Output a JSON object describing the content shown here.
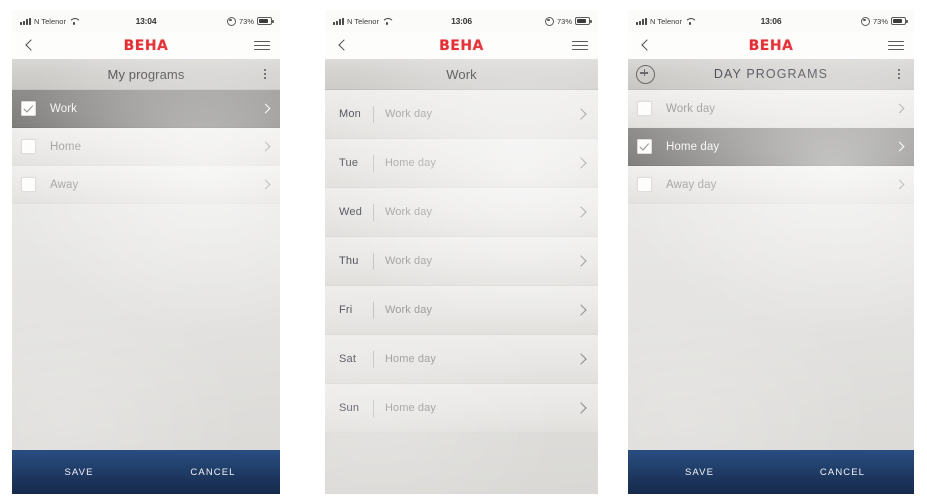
{
  "panels": [
    {
      "id": "my-programs",
      "status": {
        "carrier": "N Telenor",
        "time": "13:04",
        "battery": "73%",
        "signal_icon": "signal-bars-icon",
        "wifi_icon": "wifi-icon",
        "lock_icon": "rotation-lock-icon",
        "battery_icon": "battery-icon"
      },
      "header": {
        "back_icon": "back-chevron-icon",
        "brand": "BEHA",
        "menu_icon": "hamburger-menu-icon"
      },
      "titlebar": {
        "title": "My programs",
        "has_add": false,
        "has_kebab": true,
        "kebab_icon": "kebab-menu-icon"
      },
      "rows": [
        {
          "label": "Work",
          "checked": true,
          "selected": true
        },
        {
          "label": "Home",
          "checked": false,
          "selected": false
        },
        {
          "label": "Away",
          "checked": false,
          "selected": false
        }
      ],
      "actions": {
        "save": "SAVE",
        "cancel": "CANCEL",
        "visible": true
      }
    },
    {
      "id": "work-week",
      "status": {
        "carrier": "N Telenor",
        "time": "13:06",
        "battery": "73%",
        "signal_icon": "signal-bars-icon",
        "wifi_icon": "wifi-icon",
        "lock_icon": "rotation-lock-icon",
        "battery_icon": "battery-icon"
      },
      "header": {
        "back_icon": "back-chevron-icon",
        "brand": "BEHA",
        "menu_icon": "hamburger-menu-icon"
      },
      "titlebar": {
        "title": "Work",
        "has_add": false,
        "has_kebab": false
      },
      "days": [
        {
          "day": "Mon",
          "value": "Work day"
        },
        {
          "day": "Tue",
          "value": "Home day"
        },
        {
          "day": "Wed",
          "value": "Work day"
        },
        {
          "day": "Thu",
          "value": "Work day"
        },
        {
          "day": "Fri",
          "value": "Work day"
        },
        {
          "day": "Sat",
          "value": "Home day"
        },
        {
          "day": "Sun",
          "value": "Home day"
        }
      ],
      "actions": {
        "visible": false
      }
    },
    {
      "id": "day-programs",
      "status": {
        "carrier": "N Telenor",
        "time": "13:06",
        "battery": "73%",
        "signal_icon": "signal-bars-icon",
        "wifi_icon": "wifi-icon",
        "lock_icon": "rotation-lock-icon",
        "battery_icon": "battery-icon"
      },
      "header": {
        "back_icon": "back-chevron-icon",
        "brand": "BEHA",
        "menu_icon": "hamburger-menu-icon"
      },
      "titlebar": {
        "title": "DAY PROGRAMS",
        "has_add": true,
        "add_icon": "plus-circle-icon",
        "has_kebab": true,
        "kebab_icon": "kebab-menu-icon"
      },
      "rows": [
        {
          "label": "Work day",
          "checked": false,
          "selected": false
        },
        {
          "label": "Home day",
          "checked": true,
          "selected": true
        },
        {
          "label": "Away day",
          "checked": false,
          "selected": false
        }
      ],
      "actions": {
        "save": "SAVE",
        "cancel": "CANCEL",
        "visible": true
      }
    }
  ],
  "colors": {
    "brand_red": "#e01b22",
    "action_bar_navy": "#1b335a",
    "selected_row_gray": "#868583"
  }
}
